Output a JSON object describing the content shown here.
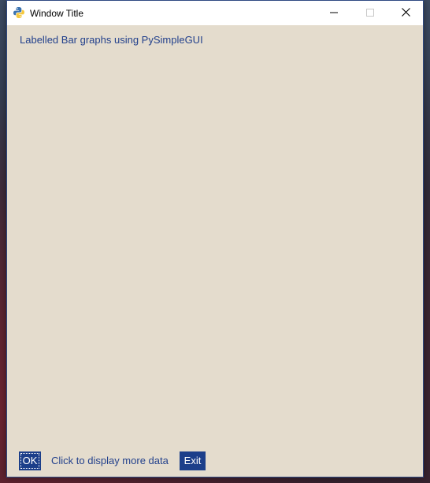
{
  "window": {
    "title": "Window Title",
    "controls": [
      "minimize-icon",
      "maximize-icon",
      "close-icon"
    ]
  },
  "main": {
    "heading": "Labelled Bar graphs using PySimpleGUI",
    "status_text": "Click to display more data"
  },
  "buttons": {
    "ok_label": "OK",
    "exit_label": "Exit"
  },
  "colors": {
    "window_background": "#e4dccd",
    "text": "#23418c",
    "button_background": "#1c3f8a",
    "button_text": "#ffffff"
  },
  "icons": {
    "app": "python-logo-icon"
  }
}
